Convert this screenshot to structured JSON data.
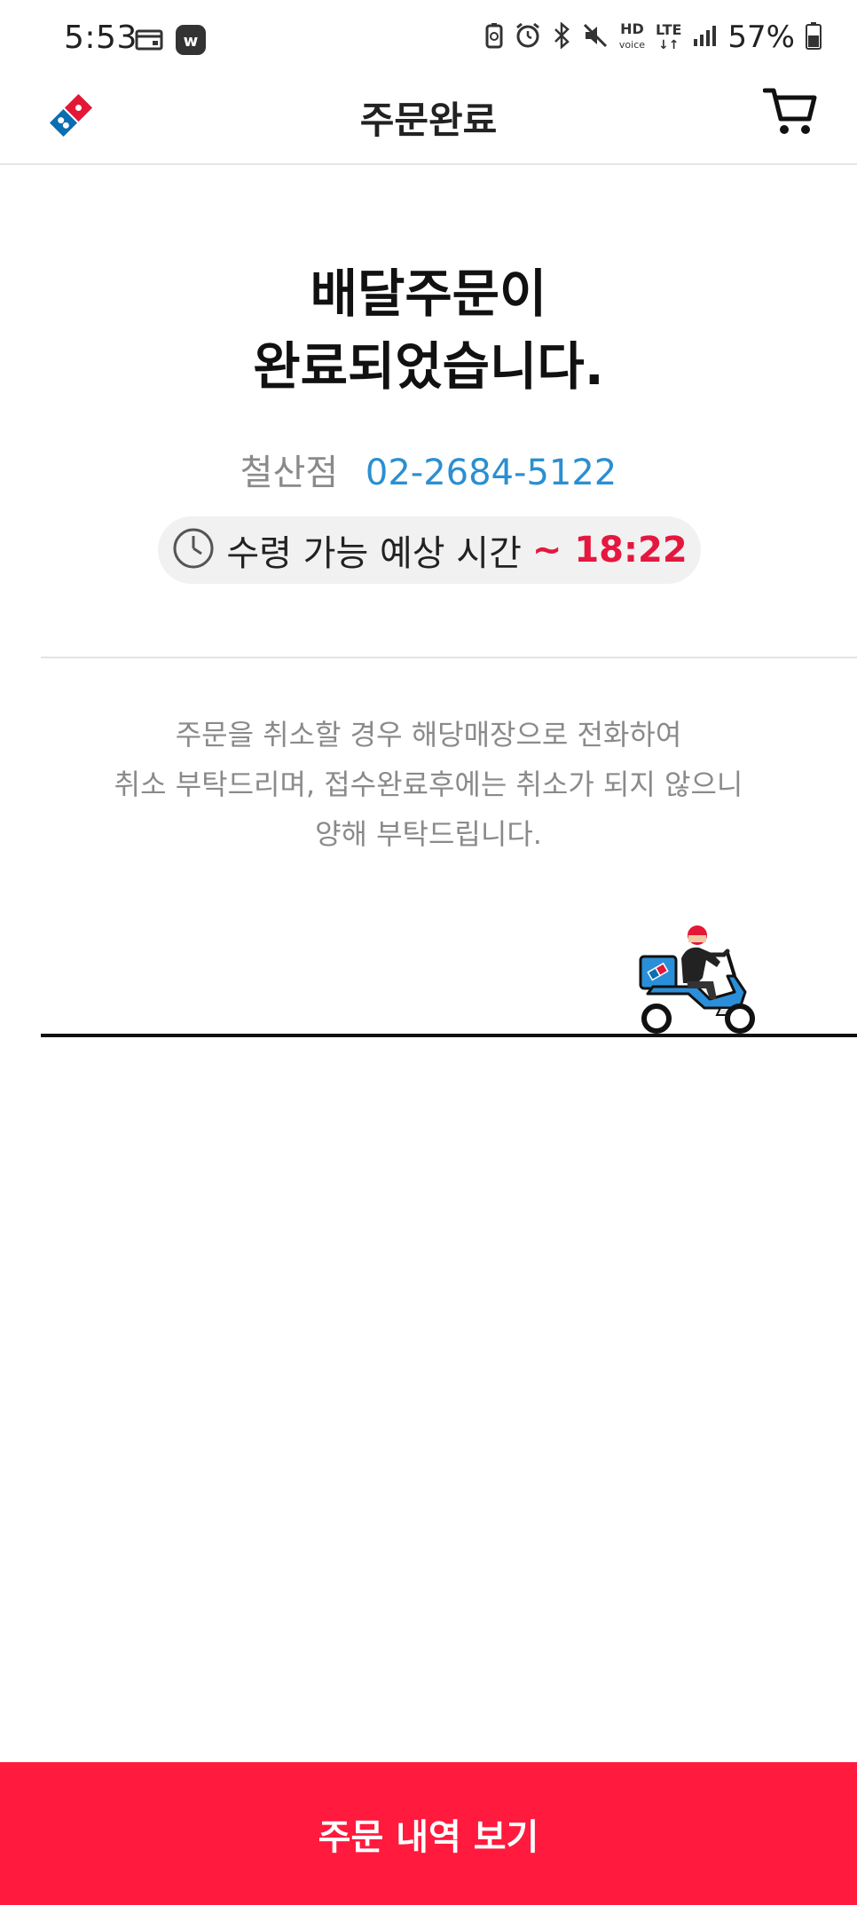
{
  "status_bar": {
    "time": "5:53",
    "battery": "57%",
    "network": "LTE",
    "hd_label": "HD",
    "voice_label": "voice",
    "icons": [
      "card-icon",
      "w-app-icon",
      "battery-saver-icon",
      "alarm-icon",
      "bluetooth-icon",
      "mute-icon",
      "signal-icon",
      "battery-icon"
    ]
  },
  "header": {
    "title": "주문완료",
    "logo": "dominos-logo-icon",
    "cart_icon": "cart-icon"
  },
  "main": {
    "headline_line1": "배달주문이",
    "headline_line2": "완료되었습니다.",
    "store_name": "철산점",
    "store_phone": "02-2684-5122",
    "eta_label": "수령 가능 예상 시간",
    "eta_time": "~ 18:22",
    "notice_line1": "주문을 취소할 경우 해당매장으로 전화하여",
    "notice_line2": "취소 부탁드리며, 접수완료후에는 취소가 되지 않으니",
    "notice_line3": "양해 부탁드립니다."
  },
  "footer": {
    "button_label": "주문 내역 보기"
  },
  "colors": {
    "accent_red": "#ff1a3e",
    "phone_blue": "#2b8fd0",
    "eta_red": "#e5173f",
    "dominos_blue": "#0b6db2"
  }
}
